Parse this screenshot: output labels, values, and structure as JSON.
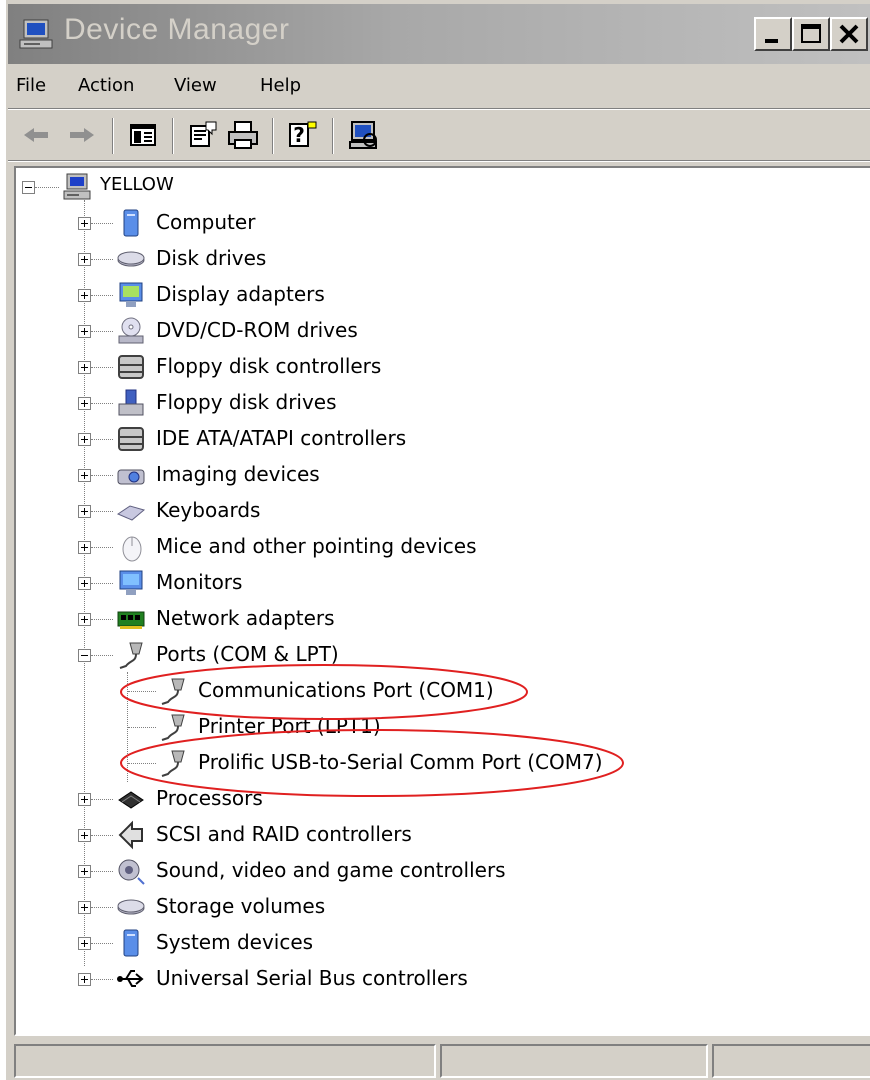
{
  "window": {
    "title": "Device Manager"
  },
  "titlebar_buttons": [
    "minimize-icon",
    "maximize-icon",
    "close-icon"
  ],
  "menu": [
    "File",
    "Action",
    "View",
    "Help"
  ],
  "toolbar": [
    "back-arrow-icon",
    "forward-arrow-icon",
    "show-hide-console-tree-icon",
    "properties-icon",
    "print-icon",
    "help-icon",
    "scan-hardware-icon"
  ],
  "tree": {
    "root": "YELLOW",
    "categories": [
      {
        "label": "Computer",
        "icon": "computer-icon"
      },
      {
        "label": "Disk drives",
        "icon": "disk-drive-icon"
      },
      {
        "label": "Display adapters",
        "icon": "display-adapter-icon"
      },
      {
        "label": "DVD/CD-ROM drives",
        "icon": "cdrom-icon"
      },
      {
        "label": "Floppy disk controllers",
        "icon": "controller-icon"
      },
      {
        "label": "Floppy disk drives",
        "icon": "floppy-drive-icon"
      },
      {
        "label": "IDE ATA/ATAPI controllers",
        "icon": "controller-icon"
      },
      {
        "label": "Imaging devices",
        "icon": "camera-icon"
      },
      {
        "label": "Keyboards",
        "icon": "keyboard-icon"
      },
      {
        "label": "Mice and other pointing devices",
        "icon": "mouse-icon"
      },
      {
        "label": "Monitors",
        "icon": "monitor-icon"
      },
      {
        "label": "Network adapters",
        "icon": "network-card-icon"
      },
      {
        "label": "Ports (COM & LPT)",
        "icon": "port-connector-icon",
        "expanded": true,
        "children": [
          {
            "label": "Communications Port (COM1)",
            "highlighted": true
          },
          {
            "label": "Printer Port (LPT1)",
            "highlighted": false
          },
          {
            "label": "Prolific USB-to-Serial Comm Port (COM7)",
            "highlighted": true
          }
        ]
      },
      {
        "label": "Processors",
        "icon": "processor-icon"
      },
      {
        "label": "SCSI and RAID controllers",
        "icon": "scsi-icon"
      },
      {
        "label": "Sound, video and game controllers",
        "icon": "speaker-icon"
      },
      {
        "label": "Storage volumes",
        "icon": "storage-volume-icon"
      },
      {
        "label": "System devices",
        "icon": "system-device-icon"
      },
      {
        "label": "Universal Serial Bus controllers",
        "icon": "usb-icon"
      }
    ]
  },
  "colors": {
    "annotation": "#e02020",
    "chrome": "#d4d0c8",
    "inactive_title": "#808080"
  }
}
